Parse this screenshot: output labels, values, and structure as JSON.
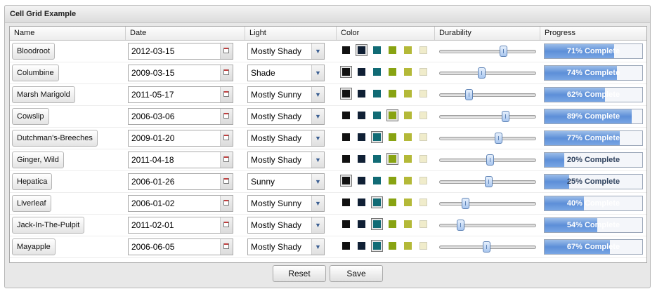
{
  "panel": {
    "title": "Cell Grid Example"
  },
  "columns": {
    "name": "Name",
    "date": "Date",
    "light": "Light",
    "color": "Color",
    "durability": "Durability",
    "progress": "Progress"
  },
  "palette": [
    "#111111",
    "#102035",
    "#116b75",
    "#88a312",
    "#b4b938",
    "#f0eccb"
  ],
  "rows": [
    {
      "name": "Bloodroot",
      "date": "2012-03-15",
      "light": "Mostly Shady",
      "color_index": 1,
      "durability": 0.68,
      "progress": 0.71,
      "progress_label": "71% Complete"
    },
    {
      "name": "Columbine",
      "date": "2009-03-15",
      "light": "Shade",
      "color_index": 0,
      "durability": 0.43,
      "progress": 0.74,
      "progress_label": "74% Complete"
    },
    {
      "name": "Marsh Marigold",
      "date": "2011-05-17",
      "light": "Mostly Sunny",
      "color_index": 0,
      "durability": 0.29,
      "progress": 0.62,
      "progress_label": "62% Complete"
    },
    {
      "name": "Cowslip",
      "date": "2006-03-06",
      "light": "Mostly Shady",
      "color_index": 3,
      "durability": 0.7,
      "progress": 0.89,
      "progress_label": "89% Complete"
    },
    {
      "name": "Dutchman's-Breeches",
      "date": "2009-01-20",
      "light": "Mostly Shady",
      "color_index": 2,
      "durability": 0.62,
      "progress": 0.77,
      "progress_label": "77% Complete"
    },
    {
      "name": "Ginger, Wild",
      "date": "2011-04-18",
      "light": "Mostly Shady",
      "color_index": 3,
      "durability": 0.53,
      "progress": 0.2,
      "progress_label": "20% Complete"
    },
    {
      "name": "Hepatica",
      "date": "2006-01-26",
      "light": "Sunny",
      "color_index": 0,
      "durability": 0.51,
      "progress": 0.25,
      "progress_label": "25% Complete"
    },
    {
      "name": "Liverleaf",
      "date": "2006-01-02",
      "light": "Mostly Sunny",
      "color_index": 2,
      "durability": 0.25,
      "progress": 0.4,
      "progress_label": "40% Complete"
    },
    {
      "name": "Jack-In-The-Pulpit",
      "date": "2011-02-01",
      "light": "Mostly Shady",
      "color_index": 2,
      "durability": 0.2,
      "progress": 0.54,
      "progress_label": "54% Complete"
    },
    {
      "name": "Mayapple",
      "date": "2006-06-05",
      "light": "Mostly Shady",
      "color_index": 2,
      "durability": 0.49,
      "progress": 0.67,
      "progress_label": "67% Complete"
    }
  ],
  "buttons": {
    "reset": "Reset",
    "save": "Save"
  }
}
